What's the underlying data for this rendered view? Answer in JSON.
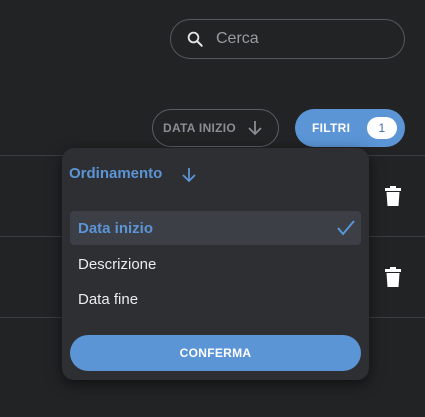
{
  "search": {
    "placeholder": "Cerca",
    "icon": "search-icon"
  },
  "toolbar": {
    "sort_label": "DATA INIZIO",
    "sort_icon": "arrow-down-icon",
    "filter_label": "FILTRI",
    "filter_count": "1"
  },
  "sort_popup": {
    "title": "Ordinamento",
    "direction_icon": "arrow-down-icon",
    "options": [
      {
        "label": "Data inizio",
        "selected": true
      },
      {
        "label": "Descrizione",
        "selected": false
      },
      {
        "label": "Data fine",
        "selected": false
      }
    ],
    "confirm_label": "CONFERMA"
  },
  "colors": {
    "accent": "#5b95d6",
    "background": "#222325",
    "popup": "#2e2f32"
  }
}
